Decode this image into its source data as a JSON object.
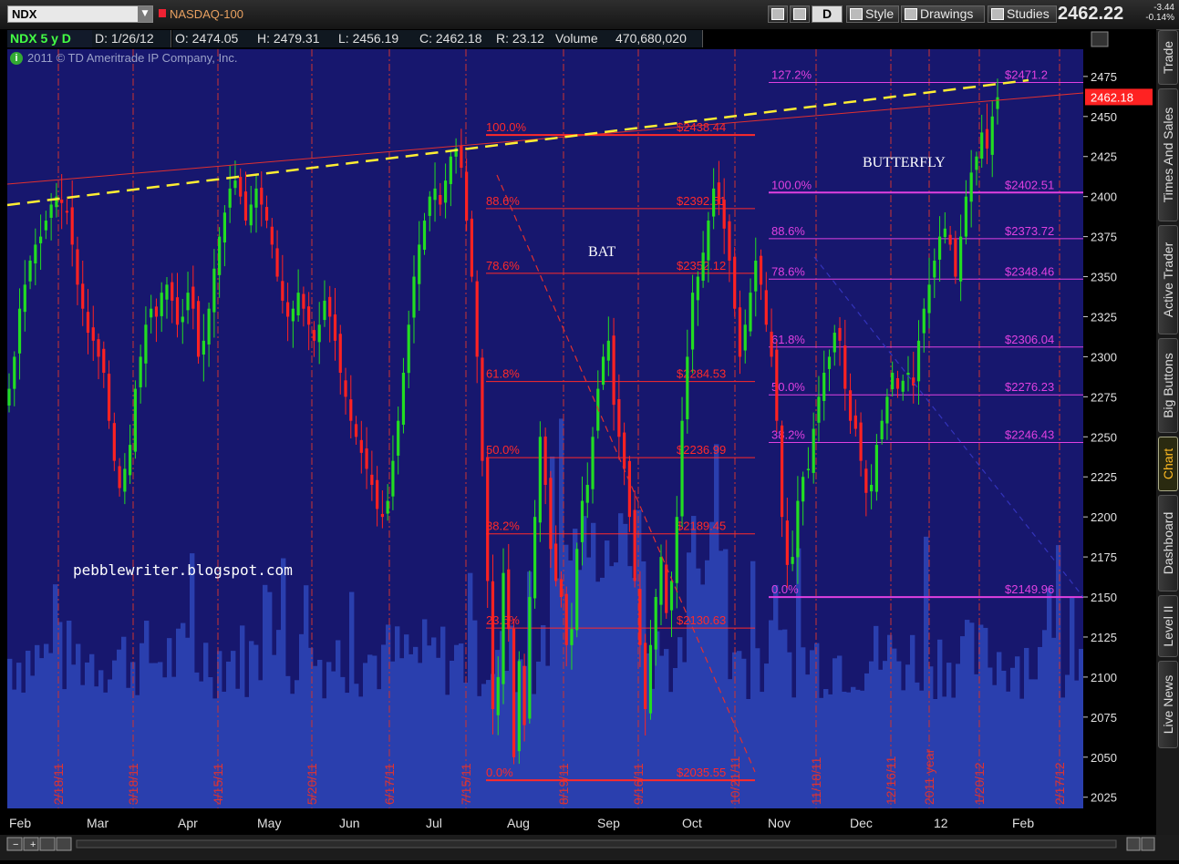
{
  "toolbar": {
    "symbol": "NDX",
    "company": "NASDAQ-100",
    "period_btn": "D",
    "style_label": "Style",
    "drawings_label": "Drawings",
    "studies_label": "Studies",
    "price": "2462.22",
    "change": "-3.44",
    "change_pct": "-0.14%"
  },
  "infobar": {
    "symbol_period": "NDX 5 y D",
    "date": "D: 1/26/12",
    "open": "O: 2474.05",
    "high": "H: 2479.31",
    "low": "L: 2456.19",
    "close": "C: 2462.18",
    "range": "R: 23.12",
    "volume_label": "Volume",
    "volume_value": "470,680,020",
    "copyright": "2011 © TD Ameritrade IP Company, Inc.",
    "info_icon": "i"
  },
  "side_tabs": [
    "Trade",
    "Times And Sales",
    "Active Trader",
    "Big Buttons",
    "Chart",
    "Dashboard",
    "Level II",
    "Live News"
  ],
  "annotations": {
    "blog": "pebblewriter.blogspot.com",
    "bat": "BAT",
    "butterfly": "BUTTERFLY"
  },
  "colors": {
    "background": "#17176e",
    "volume": "#2a3fae",
    "up_candle": "#22dd22",
    "down_candle": "#ff2222",
    "bat_lines": "#ff2a2a",
    "butterfly_lines": "#e040e0",
    "trendline": "#ffee33",
    "accent_tab": "#ffbb22"
  },
  "chart_data": {
    "type": "candlestick",
    "ylim": [
      2018,
      2492
    ],
    "y_ticks": [
      2475,
      2450,
      2425,
      2400,
      2375,
      2350,
      2325,
      2300,
      2275,
      2250,
      2225,
      2200,
      2175,
      2150,
      2125,
      2100,
      2075,
      2050,
      2025
    ],
    "month_labels": [
      "Feb",
      "Mar",
      "Apr",
      "May",
      "Jun",
      "Jul",
      "Aug",
      "Sep",
      "Oct",
      "Nov",
      "Dec",
      "12",
      "Feb"
    ],
    "date_markers": [
      "2/18/11",
      "3/18/11",
      "4/15/11",
      "5/20/11",
      "6/17/11",
      "7/15/11",
      "8/19/11",
      "9/16/11",
      "10/21/11",
      "11/18/11",
      "12/16/11",
      "2011 year",
      "1/20/12",
      "2/17/12"
    ],
    "last_price": "2462.18",
    "bat_fib_levels": [
      {
        "pct": "100.0%",
        "value": 2438.44,
        "label": "$2438.44"
      },
      {
        "pct": "88.6%",
        "value": 2392.51,
        "label": "$2392.51"
      },
      {
        "pct": "78.6%",
        "value": 2352.12,
        "label": "$2352.12"
      },
      {
        "pct": "61.8%",
        "value": 2284.53,
        "label": "$2284.53"
      },
      {
        "pct": "50.0%",
        "value": 2236.99,
        "label": "$2236.99"
      },
      {
        "pct": "38.2%",
        "value": 2189.45,
        "label": "$2189.45"
      },
      {
        "pct": "23.6%",
        "value": 2130.63,
        "label": "$2130.63"
      },
      {
        "pct": "0.0%",
        "value": 2035.55,
        "label": "$2035.55"
      }
    ],
    "butterfly_fib_levels": [
      {
        "pct": "127.2%",
        "value": 2471.2,
        "label": "$2471.2"
      },
      {
        "pct": "100.0%",
        "value": 2402.51,
        "label": "$2402.51"
      },
      {
        "pct": "88.6%",
        "value": 2373.72,
        "label": "$2373.72"
      },
      {
        "pct": "78.6%",
        "value": 2348.46,
        "label": "$2348.46"
      },
      {
        "pct": "61.8%",
        "value": 2306.04,
        "label": "$2306.04"
      },
      {
        "pct": "50.0%",
        "value": 2276.23,
        "label": "$2276.23"
      },
      {
        "pct": "38.2%",
        "value": 2246.43,
        "label": "$2246.43"
      },
      {
        "pct": "0.0%",
        "value": 2149.96,
        "label": "$2149.96"
      }
    ],
    "closes": [
      2280,
      2300,
      2330,
      2345,
      2360,
      2370,
      2375,
      2385,
      2395,
      2400,
      2396,
      2390,
      2370,
      2345,
      2330,
      2315,
      2310,
      2300,
      2290,
      2260,
      2235,
      2218,
      2230,
      2245,
      2280,
      2300,
      2320,
      2330,
      2325,
      2340,
      2345,
      2335,
      2320,
      2325,
      2340,
      2330,
      2300,
      2310,
      2330,
      2355,
      2375,
      2390,
      2405,
      2410,
      2400,
      2385,
      2395,
      2405,
      2395,
      2385,
      2370,
      2350,
      2335,
      2325,
      2330,
      2340,
      2330,
      2320,
      2310,
      2320,
      2335,
      2325,
      2310,
      2290,
      2275,
      2260,
      2250,
      2240,
      2230,
      2220,
      2205,
      2200,
      2210,
      2235,
      2260,
      2290,
      2320,
      2350,
      2370,
      2385,
      2400,
      2405,
      2395,
      2410,
      2425,
      2430,
      2418,
      2385,
      2350,
      2300,
      2235,
      2160,
      2080,
      2100,
      2165,
      2130,
      2050,
      2110,
      2070,
      2150,
      2200,
      2250,
      2220,
      2180,
      2160,
      2150,
      2120,
      2130,
      2180,
      2210,
      2220,
      2250,
      2280,
      2300,
      2310,
      2270,
      2250,
      2230,
      2200,
      2160,
      2120,
      2080,
      2120,
      2150,
      2175,
      2140,
      2160,
      2200,
      2260,
      2300,
      2340,
      2350,
      2365,
      2385,
      2405,
      2395,
      2380,
      2360,
      2330,
      2300,
      2320,
      2340,
      2360,
      2345,
      2320,
      2300,
      2260,
      2200,
      2170,
      2175,
      2210,
      2225,
      2230,
      2255,
      2275,
      2290,
      2300,
      2315,
      2310,
      2280,
      2260,
      2255,
      2235,
      2215,
      2220,
      2245,
      2260,
      2275,
      2290,
      2280,
      2285,
      2290,
      2282,
      2310,
      2330,
      2345,
      2360,
      2375,
      2380,
      2370,
      2350,
      2375,
      2400,
      2415,
      2425,
      2440,
      2430,
      2450,
      2462
    ]
  }
}
